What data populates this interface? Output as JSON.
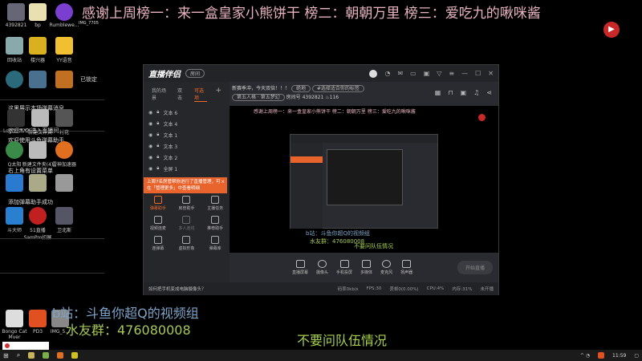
{
  "overlay": {
    "banner": "感谢上周榜一：来一盒皇家小熊饼干 榜二：朝朝万里 榜三：爱吃九的啾咪酱",
    "bilibili": "b站：斗鱼你超Q的视频组",
    "fan_group": "水友群：476080008",
    "notice": "不要问队伍情况"
  },
  "desktop": {
    "icons": [
      "4392821",
      "bp",
      "Rumblewe...",
      "IMG_7705",
      "回收站",
      "楼兴器",
      "YY语音",
      "已锁定",
      "Logitech G",
      "新建文件夹",
      "村花",
      "Q太阳",
      "新建文件夹(4)",
      "雷神加速器",
      "斗大师",
      "51直播SamPro扣屏",
      "卫北斯",
      "Bongo Cat Mver",
      "PD3",
      "IMG_5..."
    ],
    "chat_lines": [
      "这里展示本场弹幕消息",
      "欢迎XXX进入直播间",
      "欢迎使用斗鱼弹幕助手",
      "右上角有设置菜单",
      "添加弹幕助手成功"
    ]
  },
  "app": {
    "title": "直播伴侣",
    "badge": "房间",
    "tabs": [
      "我的场景",
      "双击",
      "可选项"
    ],
    "layers": [
      "文本 6",
      "文本 4",
      "文本 1",
      "文本 3",
      "文本 2",
      "全屏 1"
    ],
    "room_title": "新赛季冲，今天双倍！！！",
    "category": "绝地",
    "tag": "#选择适合你的标签",
    "section": "第五人格 · 第五梦幻",
    "room_label": "房间号",
    "room_id": "4392821",
    "hot": "116",
    "tip": "上周7名房管帮你进行了直播管理，可在「管理更多」中查看明细",
    "tools": [
      "弹幕助手",
      "房管助手",
      "主播任务",
      "视频连麦",
      "多人连线",
      "推荐助手",
      "连弹幕",
      "虚拟形象",
      "弹幕库"
    ],
    "bottom": [
      "直播屏幕",
      "摄像头",
      "手机投屏",
      "多媒体",
      "麦克风",
      "扬声器"
    ],
    "start_button": "开始直播",
    "status_hint": "如何把手机变成电脑摄像头？",
    "status": [
      "码率0kb/s",
      "FPS:30",
      "丢帧0(0.00%)",
      "CPU:4%",
      "内存:31%",
      "未开播"
    ]
  },
  "taskbar": {
    "time": "11:59"
  },
  "colors": {
    "accent": "#f06a2a",
    "banner": "#e8b4c0",
    "green": "#a6d050"
  }
}
